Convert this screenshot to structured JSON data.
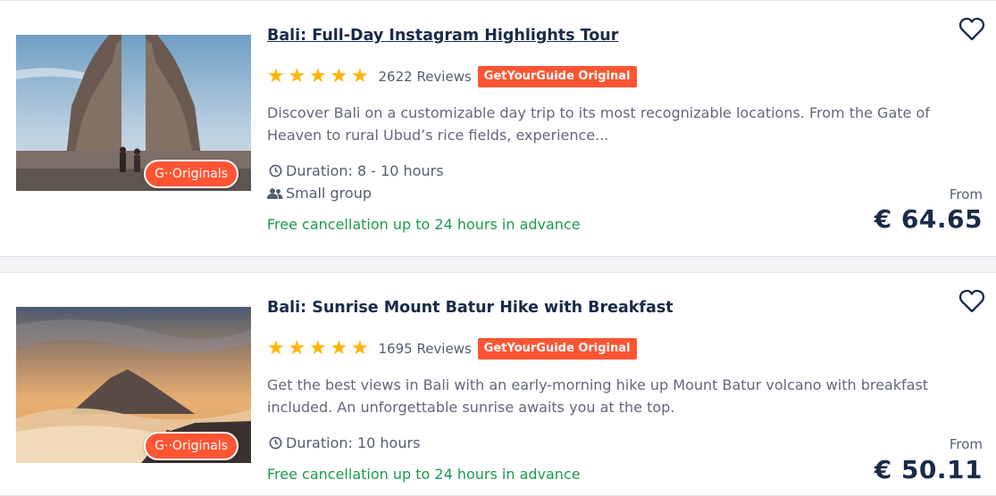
{
  "colors": {
    "accent": "#ff5533",
    "star": "#ffb400",
    "cancel_green": "#1c9a4f",
    "title": "#1a2b49"
  },
  "listings": [
    {
      "title": "Bali: Full-Day Instagram Highlights Tour",
      "rating_stars": 5,
      "reviews": "2622 Reviews",
      "badge": "GetYourGuide Original",
      "image_badge": "G··Originals",
      "description": "Discover Bali on a customizable day trip to its most recognizable locations. From the Gate of Heaven to rural Ubud’s rice fields, experience...",
      "duration": "Duration: 8 - 10 hours",
      "group": "Small group",
      "cancellation": "Free cancellation up to 24 hours in advance",
      "from_label": "From",
      "price": "€ 64.65",
      "icons": [
        "clock-icon",
        "group-icon",
        "heart-icon",
        "star-icon"
      ]
    },
    {
      "title": "Bali: Sunrise Mount Batur Hike with Breakfast",
      "rating_stars": 5,
      "reviews": "1695 Reviews",
      "badge": "GetYourGuide Original",
      "image_badge": "G··Originals",
      "description": "Get the best views in Bali with an early-morning hike up Mount Batur volcano with breakfast included. An unforgettable sunrise awaits you at the top.",
      "duration": "Duration: 10 hours",
      "cancellation": "Free cancellation up to 24 hours in advance",
      "from_label": "From",
      "price": "€ 50.11",
      "icons": [
        "clock-icon",
        "heart-icon",
        "star-icon"
      ]
    }
  ]
}
